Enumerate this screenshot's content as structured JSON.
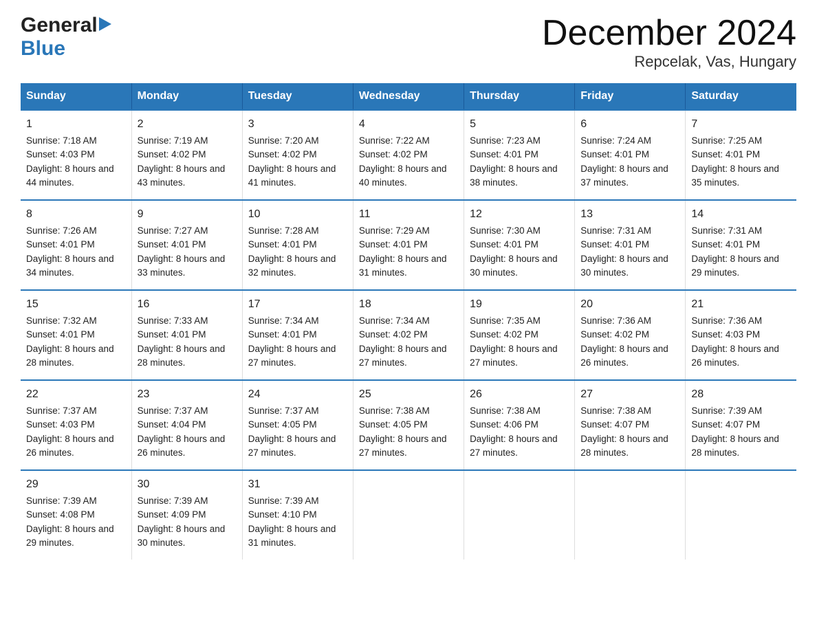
{
  "logo": {
    "line1": "General",
    "arrow": "▶",
    "line2": "Blue"
  },
  "title": "December 2024",
  "subtitle": "Repcelak, Vas, Hungary",
  "days_of_week": [
    "Sunday",
    "Monday",
    "Tuesday",
    "Wednesday",
    "Thursday",
    "Friday",
    "Saturday"
  ],
  "weeks": [
    [
      {
        "day": "1",
        "sunrise": "7:18 AM",
        "sunset": "4:03 PM",
        "daylight": "8 hours and 44 minutes."
      },
      {
        "day": "2",
        "sunrise": "7:19 AM",
        "sunset": "4:02 PM",
        "daylight": "8 hours and 43 minutes."
      },
      {
        "day": "3",
        "sunrise": "7:20 AM",
        "sunset": "4:02 PM",
        "daylight": "8 hours and 41 minutes."
      },
      {
        "day": "4",
        "sunrise": "7:22 AM",
        "sunset": "4:02 PM",
        "daylight": "8 hours and 40 minutes."
      },
      {
        "day": "5",
        "sunrise": "7:23 AM",
        "sunset": "4:01 PM",
        "daylight": "8 hours and 38 minutes."
      },
      {
        "day": "6",
        "sunrise": "7:24 AM",
        "sunset": "4:01 PM",
        "daylight": "8 hours and 37 minutes."
      },
      {
        "day": "7",
        "sunrise": "7:25 AM",
        "sunset": "4:01 PM",
        "daylight": "8 hours and 35 minutes."
      }
    ],
    [
      {
        "day": "8",
        "sunrise": "7:26 AM",
        "sunset": "4:01 PM",
        "daylight": "8 hours and 34 minutes."
      },
      {
        "day": "9",
        "sunrise": "7:27 AM",
        "sunset": "4:01 PM",
        "daylight": "8 hours and 33 minutes."
      },
      {
        "day": "10",
        "sunrise": "7:28 AM",
        "sunset": "4:01 PM",
        "daylight": "8 hours and 32 minutes."
      },
      {
        "day": "11",
        "sunrise": "7:29 AM",
        "sunset": "4:01 PM",
        "daylight": "8 hours and 31 minutes."
      },
      {
        "day": "12",
        "sunrise": "7:30 AM",
        "sunset": "4:01 PM",
        "daylight": "8 hours and 30 minutes."
      },
      {
        "day": "13",
        "sunrise": "7:31 AM",
        "sunset": "4:01 PM",
        "daylight": "8 hours and 30 minutes."
      },
      {
        "day": "14",
        "sunrise": "7:31 AM",
        "sunset": "4:01 PM",
        "daylight": "8 hours and 29 minutes."
      }
    ],
    [
      {
        "day": "15",
        "sunrise": "7:32 AM",
        "sunset": "4:01 PM",
        "daylight": "8 hours and 28 minutes."
      },
      {
        "day": "16",
        "sunrise": "7:33 AM",
        "sunset": "4:01 PM",
        "daylight": "8 hours and 28 minutes."
      },
      {
        "day": "17",
        "sunrise": "7:34 AM",
        "sunset": "4:01 PM",
        "daylight": "8 hours and 27 minutes."
      },
      {
        "day": "18",
        "sunrise": "7:34 AM",
        "sunset": "4:02 PM",
        "daylight": "8 hours and 27 minutes."
      },
      {
        "day": "19",
        "sunrise": "7:35 AM",
        "sunset": "4:02 PM",
        "daylight": "8 hours and 27 minutes."
      },
      {
        "day": "20",
        "sunrise": "7:36 AM",
        "sunset": "4:02 PM",
        "daylight": "8 hours and 26 minutes."
      },
      {
        "day": "21",
        "sunrise": "7:36 AM",
        "sunset": "4:03 PM",
        "daylight": "8 hours and 26 minutes."
      }
    ],
    [
      {
        "day": "22",
        "sunrise": "7:37 AM",
        "sunset": "4:03 PM",
        "daylight": "8 hours and 26 minutes."
      },
      {
        "day": "23",
        "sunrise": "7:37 AM",
        "sunset": "4:04 PM",
        "daylight": "8 hours and 26 minutes."
      },
      {
        "day": "24",
        "sunrise": "7:37 AM",
        "sunset": "4:05 PM",
        "daylight": "8 hours and 27 minutes."
      },
      {
        "day": "25",
        "sunrise": "7:38 AM",
        "sunset": "4:05 PM",
        "daylight": "8 hours and 27 minutes."
      },
      {
        "day": "26",
        "sunrise": "7:38 AM",
        "sunset": "4:06 PM",
        "daylight": "8 hours and 27 minutes."
      },
      {
        "day": "27",
        "sunrise": "7:38 AM",
        "sunset": "4:07 PM",
        "daylight": "8 hours and 28 minutes."
      },
      {
        "day": "28",
        "sunrise": "7:39 AM",
        "sunset": "4:07 PM",
        "daylight": "8 hours and 28 minutes."
      }
    ],
    [
      {
        "day": "29",
        "sunrise": "7:39 AM",
        "sunset": "4:08 PM",
        "daylight": "8 hours and 29 minutes."
      },
      {
        "day": "30",
        "sunrise": "7:39 AM",
        "sunset": "4:09 PM",
        "daylight": "8 hours and 30 minutes."
      },
      {
        "day": "31",
        "sunrise": "7:39 AM",
        "sunset": "4:10 PM",
        "daylight": "8 hours and 31 minutes."
      },
      null,
      null,
      null,
      null
    ]
  ],
  "labels": {
    "sunrise": "Sunrise:",
    "sunset": "Sunset:",
    "daylight": "Daylight:"
  }
}
